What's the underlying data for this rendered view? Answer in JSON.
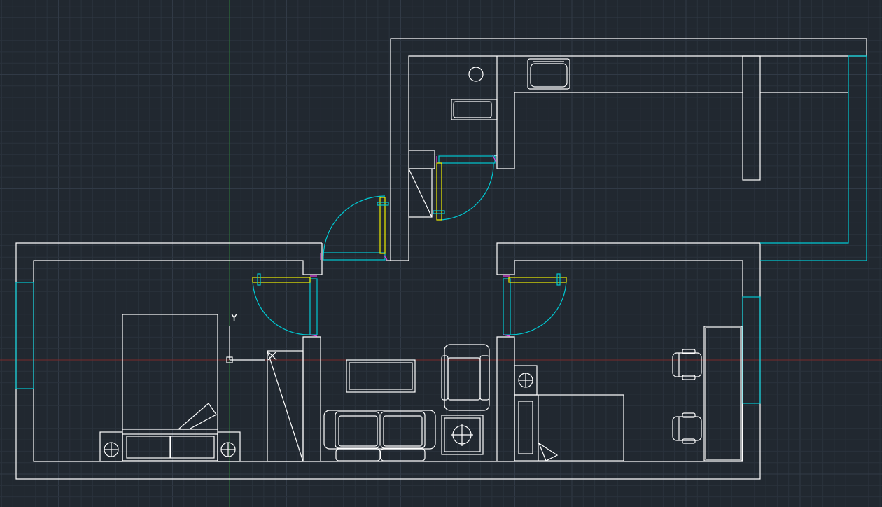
{
  "viewport": {
    "background": "#212830",
    "grid_minor_color": "#2a323c",
    "grid_major_color": "#313a46",
    "x_axis_color": "#7a2a2a",
    "y_axis_color": "#2e7a3a"
  },
  "ucs_icon": {
    "y_label": "Y",
    "x_label": "X"
  },
  "layer_colors": {
    "walls": "#ffffff",
    "windows_doors": "#00c8d2",
    "door_leaves": "#f0f000",
    "hinges": "#e040e0"
  },
  "drawing": {
    "type": "floor plan",
    "rooms": [
      "bedroom-left",
      "living-room",
      "bathroom",
      "corridor-top",
      "bedroom-right"
    ],
    "furniture": [
      "double-bed",
      "nightstand-left",
      "nightstand-right",
      "wardrobe",
      "sofa",
      "coffee-table",
      "armchair",
      "side-table",
      "bathtub",
      "washbasin",
      "toilet",
      "single-bed",
      "desk",
      "office-chair-1",
      "office-chair-2",
      "bedside-table"
    ]
  }
}
